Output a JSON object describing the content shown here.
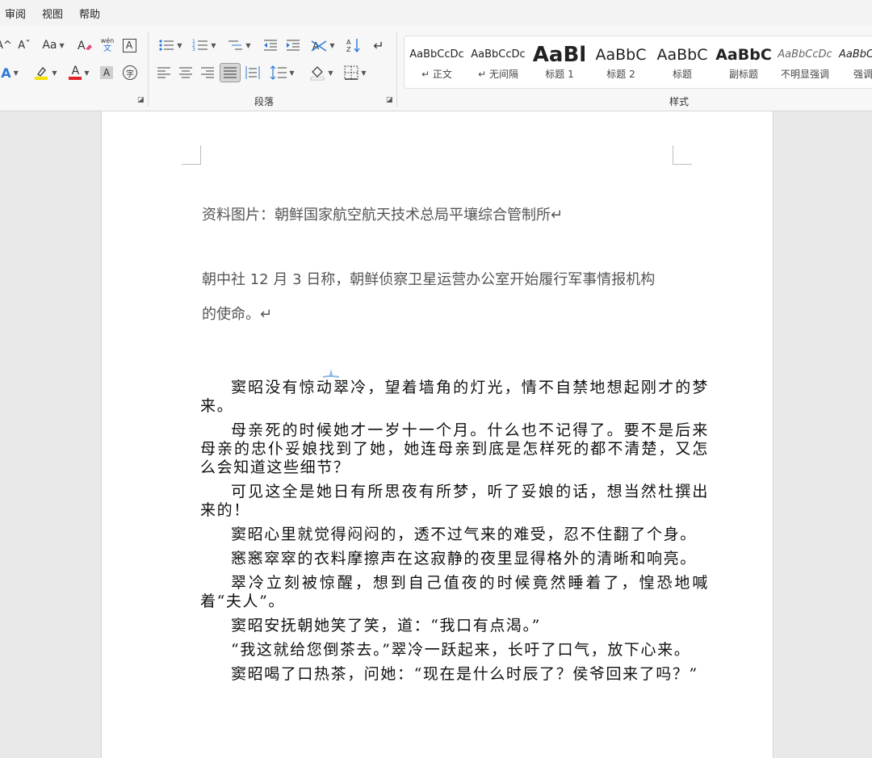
{
  "menu": {
    "items": [
      "审阅",
      "视图",
      "帮助"
    ]
  },
  "ribbon": {
    "font_group": {
      "grow_font_icon": "A^",
      "shrink_font_icon": "Aˇ",
      "change_case": "Aa",
      "phonetic_top": "wén",
      "phonetic_bottom": "文",
      "char_border": "A",
      "text_effect": "A",
      "font_color": "A",
      "char_shading": "A",
      "enclosed_char": "字",
      "highlight_color": "#f5e200",
      "font_color_value": "#e0232a",
      "text_effect_color": "#2b78d6"
    },
    "paragraph_group": {
      "label": "段落"
    },
    "styles_group": {
      "label": "样式",
      "tiles": [
        {
          "sample": "AaBbCcDc",
          "name": "↵ 正文"
        },
        {
          "sample": "AaBbCcDc",
          "name": "↵ 无间隔"
        },
        {
          "sample": "AaBl",
          "name": "标题 1"
        },
        {
          "sample": "AaBbC",
          "name": "标题 2"
        },
        {
          "sample": "AaBbC",
          "name": "标题"
        },
        {
          "sample": "AaBbC",
          "name": "副标题"
        },
        {
          "sample": "AaBbCcDc",
          "name": "不明显强调"
        },
        {
          "sample": "AaBbCc",
          "name": "强调"
        }
      ]
    }
  },
  "document": {
    "caption1": "资料图片：朝鲜国家航空航天技术总局平壤综合管制所↵",
    "caption2_line1": "朝中社 12 月 3 日称，朝鲜侦察卫星运营办公室开始履行军事情报机构",
    "caption2_line2": "的使命。↵",
    "paragraphs": [
      "窦昭没有惊动翠冷，望着墙角的灯光，情不自禁地想起刚才的梦来。",
      "母亲死的时候她才一岁十一个月。什么也不记得了。要不是后来母亲的忠仆妥娘找到了她，她连母亲到底是怎样死的都不清楚，又怎么会知道这些细节？",
      "可见这全是她日有所思夜有所梦，听了妥娘的话，想当然杜撰出来的！",
      "窦昭心里就觉得闷闷的，透不过气来的难受，忍不住翻了个身。",
      "窸窸窣窣的衣料摩擦声在这寂静的夜里显得格外的清晰和响亮。",
      "翠冷立刻被惊醒，想到自己值夜的时候竟然睡着了，惶恐地喊着“夫人”。",
      "窦昭安抚朝她笑了笑，道：“我口有点渴。”",
      "“我这就给您倒茶去。”翠冷一跃起来，长吁了口气，放下心来。",
      "窦昭喝了口热茶，问她：“现在是什么时辰了？侯爷回来了吗？”"
    ]
  }
}
